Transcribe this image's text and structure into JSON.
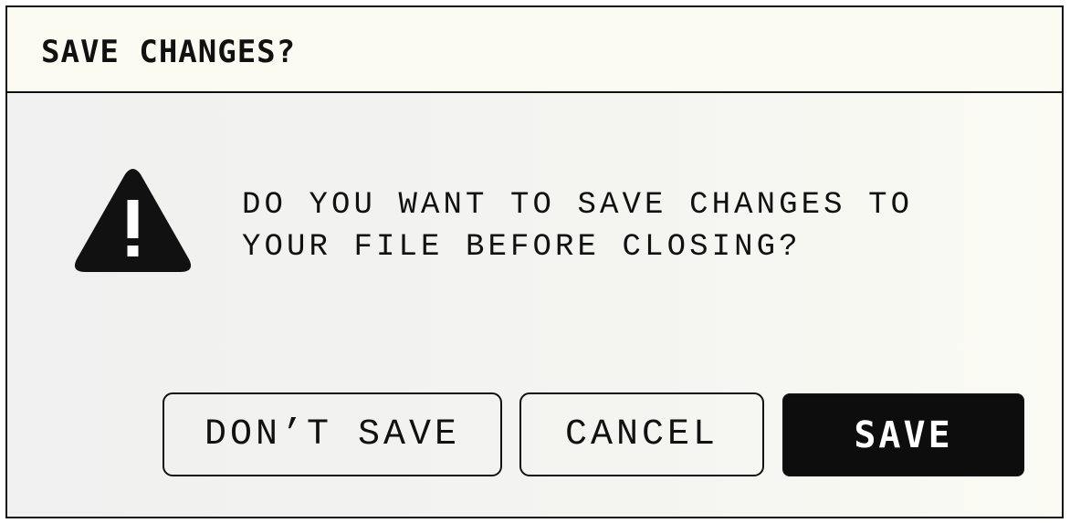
{
  "dialog": {
    "title": "SAVE CHANGES?",
    "icon": "warning-icon",
    "message_lines": [
      "DO YOU WANT TO SAVE CHANGES TO",
      "YOUR FILE BEFORE CLOSING?"
    ],
    "buttons": {
      "dont_save": "DON’T SAVE",
      "cancel": "CANCEL",
      "save": "SAVE"
    }
  },
  "colors": {
    "primary_button": "#0d0d0d",
    "text": "#111111",
    "titlebar_bg": "#fbfbf2"
  }
}
